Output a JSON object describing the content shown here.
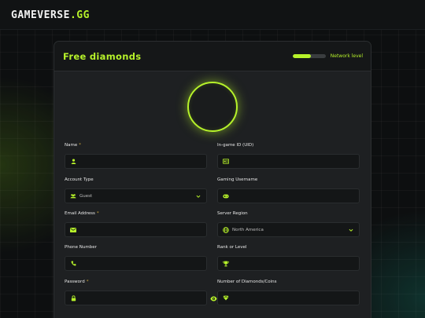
{
  "brand": {
    "name": "GAMEVERSE",
    "suffix": ".GG"
  },
  "panel": {
    "title": "Free diamonds",
    "network_label": "Network level",
    "network_level": 0.55
  },
  "colors": {
    "accent": "#b6f22a",
    "required": "#c7a33a"
  },
  "fields": {
    "name": {
      "label": "Name",
      "required": "*",
      "icon": "user-icon",
      "value": ""
    },
    "ingame_id": {
      "label": "In-game ID (UID)",
      "icon": "id-card-icon",
      "value": ""
    },
    "account_type": {
      "label": "Account Type",
      "icon": "users-icon",
      "value": "Guest"
    },
    "gaming_username": {
      "label": "Gaming Username",
      "icon": "gamepad-icon",
      "value": ""
    },
    "email": {
      "label": "Email Address",
      "required": "*",
      "icon": "envelope-icon",
      "value": ""
    },
    "server_region": {
      "label": "Server Region",
      "icon": "globe-icon",
      "value": "North America"
    },
    "phone": {
      "label": "Phone Number",
      "icon": "phone-icon",
      "value": ""
    },
    "rank": {
      "label": "Rank or Level",
      "icon": "trophy-icon",
      "value": ""
    },
    "password": {
      "label": "Password",
      "required": "*",
      "icon": "lock-icon",
      "value": ""
    },
    "diamonds": {
      "label": "Number of Diamonds/Coins",
      "icon": "gem-icon",
      "value": ""
    }
  }
}
